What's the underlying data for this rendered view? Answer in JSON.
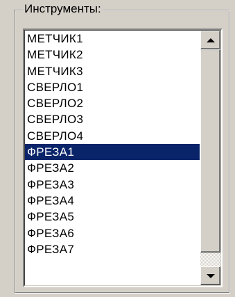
{
  "group": {
    "title": "Инструменты:"
  },
  "list": {
    "items": [
      "МЕТЧИК1",
      "МЕТЧИК2",
      "МЕТЧИК3",
      "СВЕРЛО1",
      "СВЕРЛО2",
      "СВЕРЛО3",
      "СВЕРЛО4",
      "ФРЕЗА1",
      "ФРЕЗА2",
      "ФРЕЗА3",
      "ФРЕЗА4",
      "ФРЕЗА5",
      "ФРЕЗА6",
      "ФРЕЗА7"
    ],
    "selected_index": 7
  },
  "scrollbar": {
    "up_icon": "scroll-up-arrow",
    "down_icon": "scroll-down-arrow"
  },
  "colors": {
    "selection_bg": "#0a246a",
    "window_bg": "#d4d0c8"
  }
}
